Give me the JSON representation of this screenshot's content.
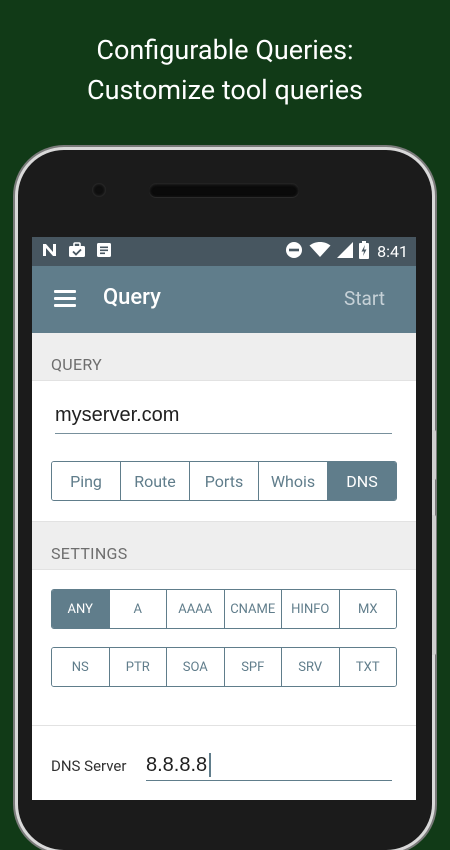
{
  "promo": {
    "line1": "Configurable Queries:",
    "line2": "Customize tool queries"
  },
  "status_bar": {
    "time": "8:41",
    "left_icons": [
      "n-icon",
      "briefcase-check-icon",
      "document-icon"
    ],
    "right_icons": [
      "dnd-icon",
      "wifi-icon",
      "signal-icon",
      "battery-charging-icon"
    ]
  },
  "appbar": {
    "title": "Query",
    "action": "Start"
  },
  "query_section": {
    "label": "QUERY",
    "host_value": "myserver.com",
    "tools": [
      "Ping",
      "Route",
      "Ports",
      "Whois",
      "DNS"
    ],
    "selected_tool": "DNS"
  },
  "settings_section": {
    "label": "SETTINGS",
    "record_types_row1": [
      "ANY",
      "A",
      "AAAA",
      "CNAME",
      "HINFO",
      "MX"
    ],
    "record_types_row2": [
      "NS",
      "PTR",
      "SOA",
      "SPF",
      "SRV",
      "TXT"
    ],
    "selected_record": "ANY",
    "dns_server_label": "DNS Server",
    "dns_server_value": "8.8.8.8"
  },
  "colors": {
    "background": "#113a17",
    "appbar": "#607d8b",
    "statusbar": "#475660",
    "accent": "#607d8b"
  }
}
